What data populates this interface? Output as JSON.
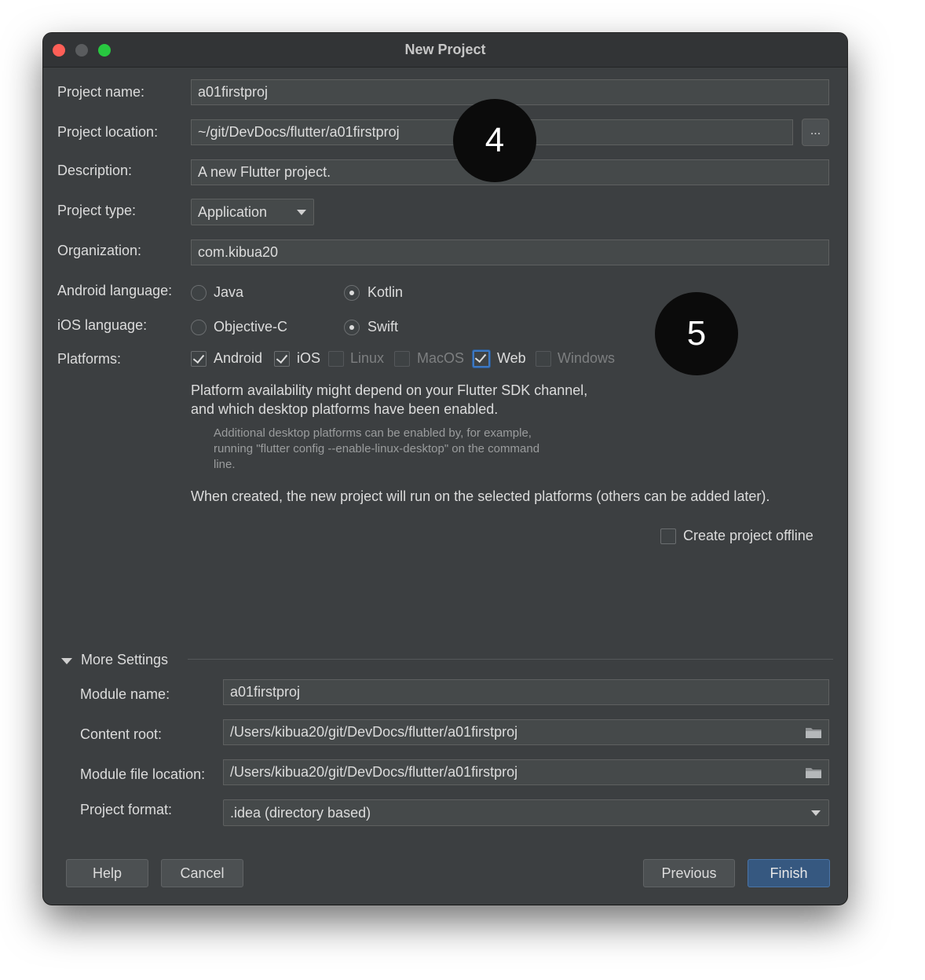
{
  "window": {
    "title": "New Project"
  },
  "form": {
    "project_name": {
      "label": "Project name:",
      "value": "a01firstproj"
    },
    "project_location": {
      "label": "Project location:",
      "value": "~/git/DevDocs/flutter/a01firstproj",
      "browse_label": "..."
    },
    "description": {
      "label": "Description:",
      "value": "A new Flutter project."
    },
    "project_type": {
      "label": "Project type:",
      "value": "Application"
    },
    "organization": {
      "label": "Organization:",
      "value": "com.kibua20"
    },
    "android_language": {
      "label": "Android language:",
      "options": [
        "Java",
        "Kotlin"
      ],
      "selected": "Kotlin"
    },
    "ios_language": {
      "label": "iOS language:",
      "options": [
        "Objective-C",
        "Swift"
      ],
      "selected": "Swift"
    },
    "platforms": {
      "label": "Platforms:",
      "items": [
        {
          "label": "Android",
          "checked": true,
          "enabled": true
        },
        {
          "label": "iOS",
          "checked": true,
          "enabled": true
        },
        {
          "label": "Linux",
          "checked": false,
          "enabled": false
        },
        {
          "label": "MacOS",
          "checked": false,
          "enabled": false
        },
        {
          "label": "Web",
          "checked": true,
          "enabled": true
        },
        {
          "label": "Windows",
          "checked": false,
          "enabled": false
        }
      ]
    },
    "platform_note_line1": "Platform availability might depend on your Flutter SDK channel,",
    "platform_note_line2": "and which desktop platforms have been enabled.",
    "desktop_note_line1": "Additional desktop platforms can be enabled by, for example,",
    "desktop_note_line2": "running \"flutter config --enable-linux-desktop\" on the command",
    "desktop_note_line3": "line.",
    "created_note": "When created, the new project will run on the selected platforms (others can be added later).",
    "offline": {
      "label": "Create project offline",
      "checked": false
    }
  },
  "more_settings": {
    "title": "More Settings",
    "module_name": {
      "label": "Module name:",
      "value": "a01firstproj"
    },
    "content_root": {
      "label": "Content root:",
      "value": "/Users/kibua20/git/DevDocs/flutter/a01firstproj"
    },
    "module_file_location": {
      "label": "Module file location:",
      "value": "/Users/kibua20/git/DevDocs/flutter/a01firstproj"
    },
    "project_format": {
      "label": "Project format:",
      "value": ".idea (directory based)"
    }
  },
  "buttons": {
    "help": "Help",
    "cancel": "Cancel",
    "previous": "Previous",
    "finish": "Finish"
  },
  "badges": {
    "first": "4",
    "second": "5"
  },
  "colors": {
    "background": "#3c3f41",
    "field": "#45494a",
    "primary": "#365880",
    "focus": "#3d78c2"
  }
}
